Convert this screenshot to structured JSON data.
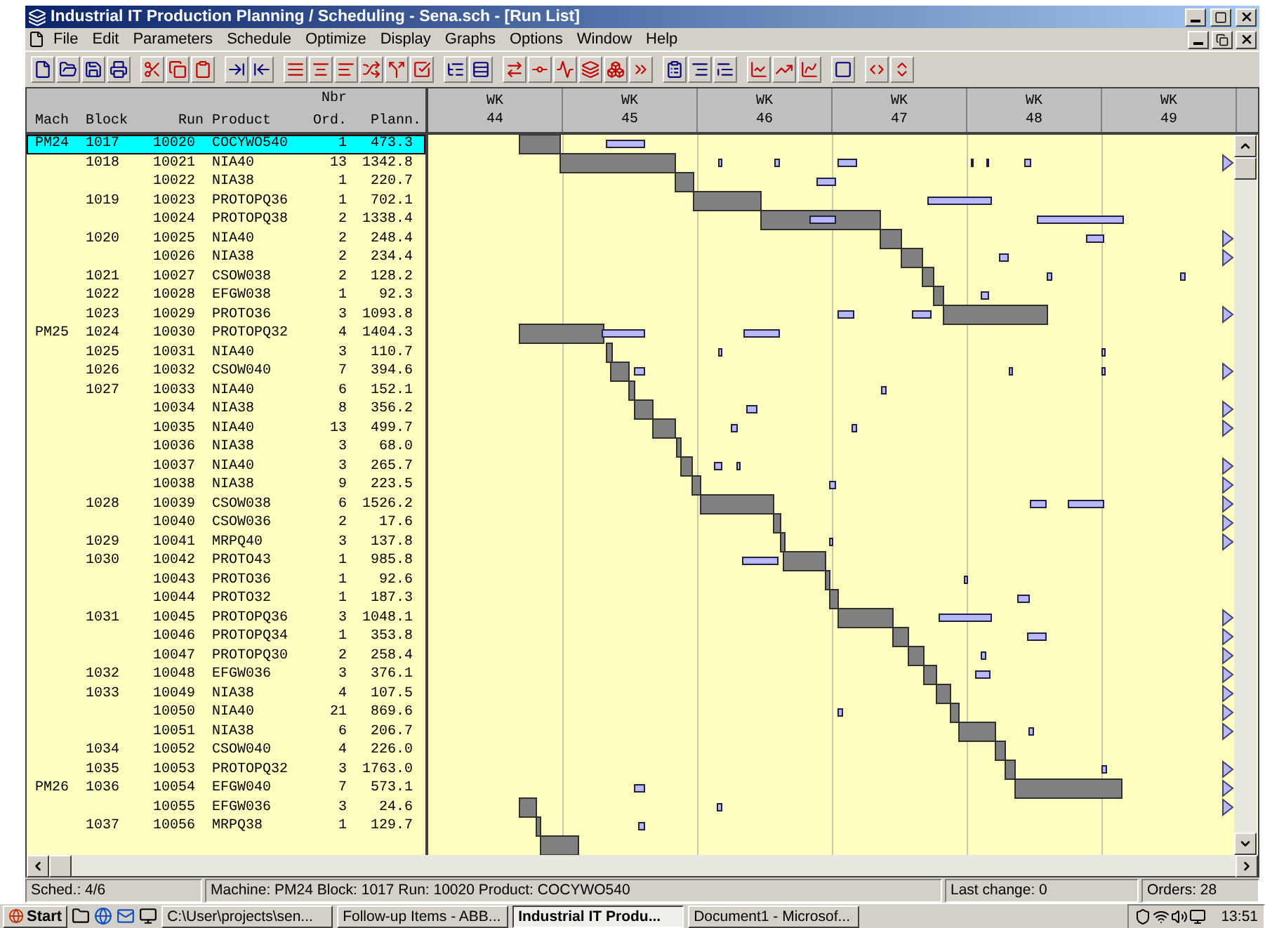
{
  "window": {
    "title": "Industrial IT Production Planning / Scheduling  -  Sena.sch - [Run List]"
  },
  "menu": [
    "File",
    "Edit",
    "Parameters",
    "Schedule",
    "Optimize",
    "Display",
    "Graphs",
    "Options",
    "Window",
    "Help"
  ],
  "table": {
    "columns": {
      "mach": "Mach",
      "block": "Block",
      "run": "Run",
      "product": "Product",
      "nbr_top": "Nbr",
      "nbr": "Ord.",
      "plann": "Plann."
    },
    "rows": [
      {
        "mach": "PM24",
        "block": "1017",
        "run": "10020",
        "product": "COCYWO540",
        "nbr": "1",
        "plann": "473.3",
        "selected": true
      },
      {
        "mach": "",
        "block": "1018",
        "run": "10021",
        "product": "NIA40",
        "nbr": "13",
        "plann": "1342.8",
        "selected": false
      },
      {
        "mach": "",
        "block": "",
        "run": "10022",
        "product": "NIA38",
        "nbr": "1",
        "plann": "220.7",
        "selected": false
      },
      {
        "mach": "",
        "block": "1019",
        "run": "10023",
        "product": "PROTOPQ36",
        "nbr": "1",
        "plann": "702.1",
        "selected": false
      },
      {
        "mach": "",
        "block": "",
        "run": "10024",
        "product": "PROTOPQ38",
        "nbr": "2",
        "plann": "1338.4",
        "selected": false
      },
      {
        "mach": "",
        "block": "1020",
        "run": "10025",
        "product": "NIA40",
        "nbr": "2",
        "plann": "248.4",
        "selected": false
      },
      {
        "mach": "",
        "block": "",
        "run": "10026",
        "product": "NIA38",
        "nbr": "2",
        "plann": "234.4",
        "selected": false
      },
      {
        "mach": "",
        "block": "1021",
        "run": "10027",
        "product": "CSOW038",
        "nbr": "2",
        "plann": "128.2",
        "selected": false
      },
      {
        "mach": "",
        "block": "1022",
        "run": "10028",
        "product": "EFGW038",
        "nbr": "1",
        "plann": "92.3",
        "selected": false
      },
      {
        "mach": "",
        "block": "1023",
        "run": "10029",
        "product": "PROTO36",
        "nbr": "3",
        "plann": "1093.8",
        "selected": false
      },
      {
        "mach": "PM25",
        "block": "1024",
        "run": "10030",
        "product": "PROTOPQ32",
        "nbr": "4",
        "plann": "1404.3",
        "selected": false
      },
      {
        "mach": "",
        "block": "1025",
        "run": "10031",
        "product": "NIA40",
        "nbr": "3",
        "plann": "110.7",
        "selected": false
      },
      {
        "mach": "",
        "block": "1026",
        "run": "10032",
        "product": "CSOW040",
        "nbr": "7",
        "plann": "394.6",
        "selected": false
      },
      {
        "mach": "",
        "block": "1027",
        "run": "10033",
        "product": "NIA40",
        "nbr": "6",
        "plann": "152.1",
        "selected": false
      },
      {
        "mach": "",
        "block": "",
        "run": "10034",
        "product": "NIA38",
        "nbr": "8",
        "plann": "356.2",
        "selected": false
      },
      {
        "mach": "",
        "block": "",
        "run": "10035",
        "product": "NIA40",
        "nbr": "13",
        "plann": "499.7",
        "selected": false
      },
      {
        "mach": "",
        "block": "",
        "run": "10036",
        "product": "NIA38",
        "nbr": "3",
        "plann": "68.0",
        "selected": false
      },
      {
        "mach": "",
        "block": "",
        "run": "10037",
        "product": "NIA40",
        "nbr": "3",
        "plann": "265.7",
        "selected": false
      },
      {
        "mach": "",
        "block": "",
        "run": "10038",
        "product": "NIA38",
        "nbr": "9",
        "plann": "223.5",
        "selected": false
      },
      {
        "mach": "",
        "block": "1028",
        "run": "10039",
        "product": "CSOW038",
        "nbr": "6",
        "plann": "1526.2",
        "selected": false
      },
      {
        "mach": "",
        "block": "",
        "run": "10040",
        "product": "CSOW036",
        "nbr": "2",
        "plann": "17.6",
        "selected": false
      },
      {
        "mach": "",
        "block": "1029",
        "run": "10041",
        "product": "MRPQ40",
        "nbr": "3",
        "plann": "137.8",
        "selected": false
      },
      {
        "mach": "",
        "block": "1030",
        "run": "10042",
        "product": "PROTO43",
        "nbr": "1",
        "plann": "985.8",
        "selected": false
      },
      {
        "mach": "",
        "block": "",
        "run": "10043",
        "product": "PROTO36",
        "nbr": "1",
        "plann": "92.6",
        "selected": false
      },
      {
        "mach": "",
        "block": "",
        "run": "10044",
        "product": "PROTO32",
        "nbr": "1",
        "plann": "187.3",
        "selected": false
      },
      {
        "mach": "",
        "block": "1031",
        "run": "10045",
        "product": "PROTOPQ36",
        "nbr": "3",
        "plann": "1048.1",
        "selected": false
      },
      {
        "mach": "",
        "block": "",
        "run": "10046",
        "product": "PROTOPQ34",
        "nbr": "1",
        "plann": "353.8",
        "selected": false
      },
      {
        "mach": "",
        "block": "",
        "run": "10047",
        "product": "PROTOPQ30",
        "nbr": "2",
        "plann": "258.4",
        "selected": false
      },
      {
        "mach": "",
        "block": "1032",
        "run": "10048",
        "product": "EFGW036",
        "nbr": "3",
        "plann": "376.1",
        "selected": false
      },
      {
        "mach": "",
        "block": "1033",
        "run": "10049",
        "product": "NIA38",
        "nbr": "4",
        "plann": "107.5",
        "selected": false
      },
      {
        "mach": "",
        "block": "",
        "run": "10050",
        "product": "NIA40",
        "nbr": "21",
        "plann": "869.6",
        "selected": false
      },
      {
        "mach": "",
        "block": "",
        "run": "10051",
        "product": "NIA38",
        "nbr": "6",
        "plann": "206.7",
        "selected": false
      },
      {
        "mach": "",
        "block": "1034",
        "run": "10052",
        "product": "CSOW040",
        "nbr": "4",
        "plann": "226.0",
        "selected": false
      },
      {
        "mach": "",
        "block": "1035",
        "run": "10053",
        "product": "PROTOPQ32",
        "nbr": "3",
        "plann": "1763.0",
        "selected": false
      },
      {
        "mach": "PM26",
        "block": "1036",
        "run": "10054",
        "product": "EFGW040",
        "nbr": "7",
        "plann": "573.1",
        "selected": false
      },
      {
        "mach": "",
        "block": "",
        "run": "10055",
        "product": "EFGW036",
        "nbr": "3",
        "plann": "24.6",
        "selected": false
      },
      {
        "mach": "",
        "block": "1037",
        "run": "10056",
        "product": "MRPQ38",
        "nbr": "1",
        "plann": "129.7",
        "selected": false
      }
    ]
  },
  "weeks": [
    {
      "label": "WK",
      "number": "44"
    },
    {
      "label": "WK",
      "number": "45"
    },
    {
      "label": "WK",
      "number": "46"
    },
    {
      "label": "WK",
      "number": "47"
    },
    {
      "label": "WK",
      "number": "48"
    },
    {
      "label": "WK",
      "number": "49"
    }
  ],
  "status_bar": {
    "sched": "Sched.: 4/6",
    "info": "Machine: PM24  Block: 1017  Run: 10020  Product: COCYWO540",
    "last_change": "Last change: 0",
    "orders": "Orders: 28"
  },
  "taskbar": {
    "start": "Start",
    "tasks": [
      {
        "label": "C:\\User\\projects\\sen...",
        "selected": false
      },
      {
        "label": "Follow-up Items - ABB...",
        "selected": false
      },
      {
        "label": "Industrial IT Produ...",
        "selected": true
      },
      {
        "label": "Document1 - Microsof...",
        "selected": false
      }
    ],
    "clock": "13:51"
  }
}
